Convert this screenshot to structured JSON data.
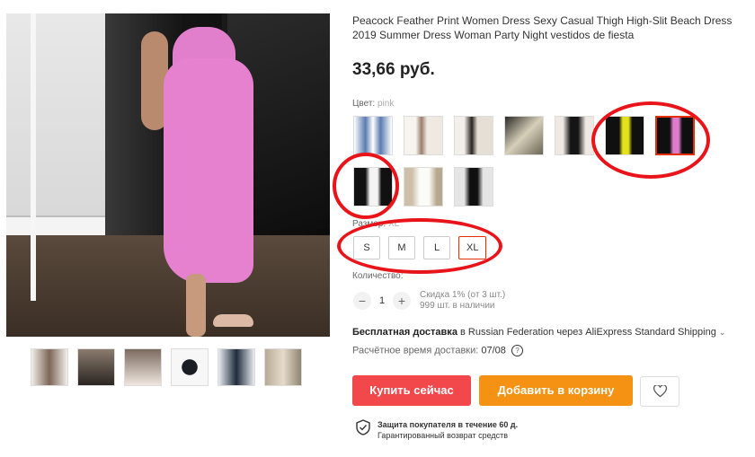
{
  "product": {
    "title": "Peacock Feather Print Women Dress Sexy Casual Thigh High-Slit Beach Dress 2019 Summer Dress Woman Party Night vestidos de fiesta",
    "price": "33,66 руб."
  },
  "color": {
    "label": "Цвет:",
    "value": "pink",
    "swatches": [
      "denim",
      "white-print",
      "black-white",
      "beige-print",
      "black-strapless",
      "yellow",
      "pink",
      "white-short",
      "white-long",
      "black-slit"
    ]
  },
  "size": {
    "label": "Размер:",
    "value": "XL",
    "options": [
      "S",
      "M",
      "L",
      "XL"
    ]
  },
  "quantity": {
    "label": "Количество:",
    "minus": "−",
    "value": "1",
    "plus": "+",
    "discount": "Скидка 1% (от 3 шт.)",
    "stock": "999 шт. в наличии"
  },
  "shipping": {
    "free_label": "Бесплатная доставка",
    "text": " в Russian Federation через AliExpress Standard Shipping",
    "delivery_label": "Расчётное время доставки:",
    "delivery_date": "07/08",
    "help_symbol": "?"
  },
  "buttons": {
    "buy": "Купить сейчас",
    "cart": "Добавить в корзину"
  },
  "protection": {
    "title": "Защита покупателя в течение 60 д.",
    "subtitle": "Гарантированный возврат средств"
  },
  "colors": {
    "buy": "#f2474b",
    "cart": "#f69213",
    "selected_border": "#e62e04",
    "annotation": "#e8141a"
  }
}
